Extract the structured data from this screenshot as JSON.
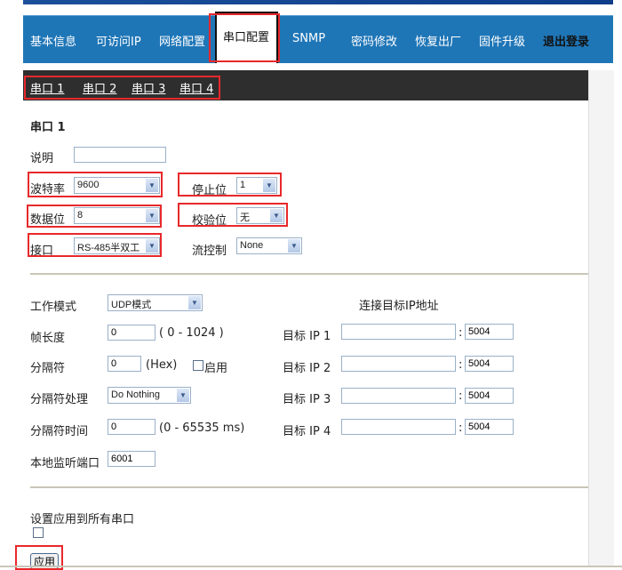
{
  "nav": {
    "items": [
      "基本信息",
      "可访问IP",
      "网络配置",
      "串口配置",
      "SNMP",
      "密码修改",
      "恢复出厂",
      "固件升级",
      "退出登录"
    ],
    "active": "串口配置"
  },
  "subnav": [
    "串口 1",
    "串口 2",
    "串口 3",
    "串口 4"
  ],
  "section_title": "串口 1",
  "port": {
    "desc_label": "说明",
    "desc_value": "",
    "baud_label": "波特率",
    "baud_value": "9600",
    "stop_label": "停止位",
    "stop_value": "1",
    "data_label": "数据位",
    "data_value": "8",
    "parity_label": "校验位",
    "parity_value": "无",
    "iface_label": "接口",
    "iface_value": "RS-485半双工",
    "flow_label": "流控制",
    "flow_value": "None"
  },
  "work": {
    "mode_label": "工作模式",
    "mode_value": "UDP模式",
    "frame_label": "帧长度",
    "frame_value": "0",
    "frame_range": "( 0 - 1024 )",
    "sep_label": "分隔符",
    "sep_value": "0",
    "sep_unit": "(Hex)",
    "sep_enable": "启用",
    "sep_proc_label": "分隔符处理",
    "sep_proc_value": "Do Nothing",
    "sep_time_label": "分隔符时间",
    "sep_time_value": "0",
    "sep_time_range": "(0 - 65535 ms)",
    "local_port_label": "本地监听端口",
    "local_port_value": "6001",
    "target_title": "连接目标IP地址",
    "targets": [
      {
        "label": "目标 IP 1",
        "ip": "",
        "port": "5004"
      },
      {
        "label": "目标 IP 2",
        "ip": "",
        "port": "5004"
      },
      {
        "label": "目标 IP 3",
        "ip": "",
        "port": "5004"
      },
      {
        "label": "目标 IP 4",
        "ip": "",
        "port": "5004"
      }
    ]
  },
  "apply_all_label": "设置应用到所有串口",
  "apply_button": "应用",
  "colors": {
    "nav_bg": "#1f76b7",
    "subnav_bg": "#2e2e2e",
    "highlight": "#e8282b"
  }
}
